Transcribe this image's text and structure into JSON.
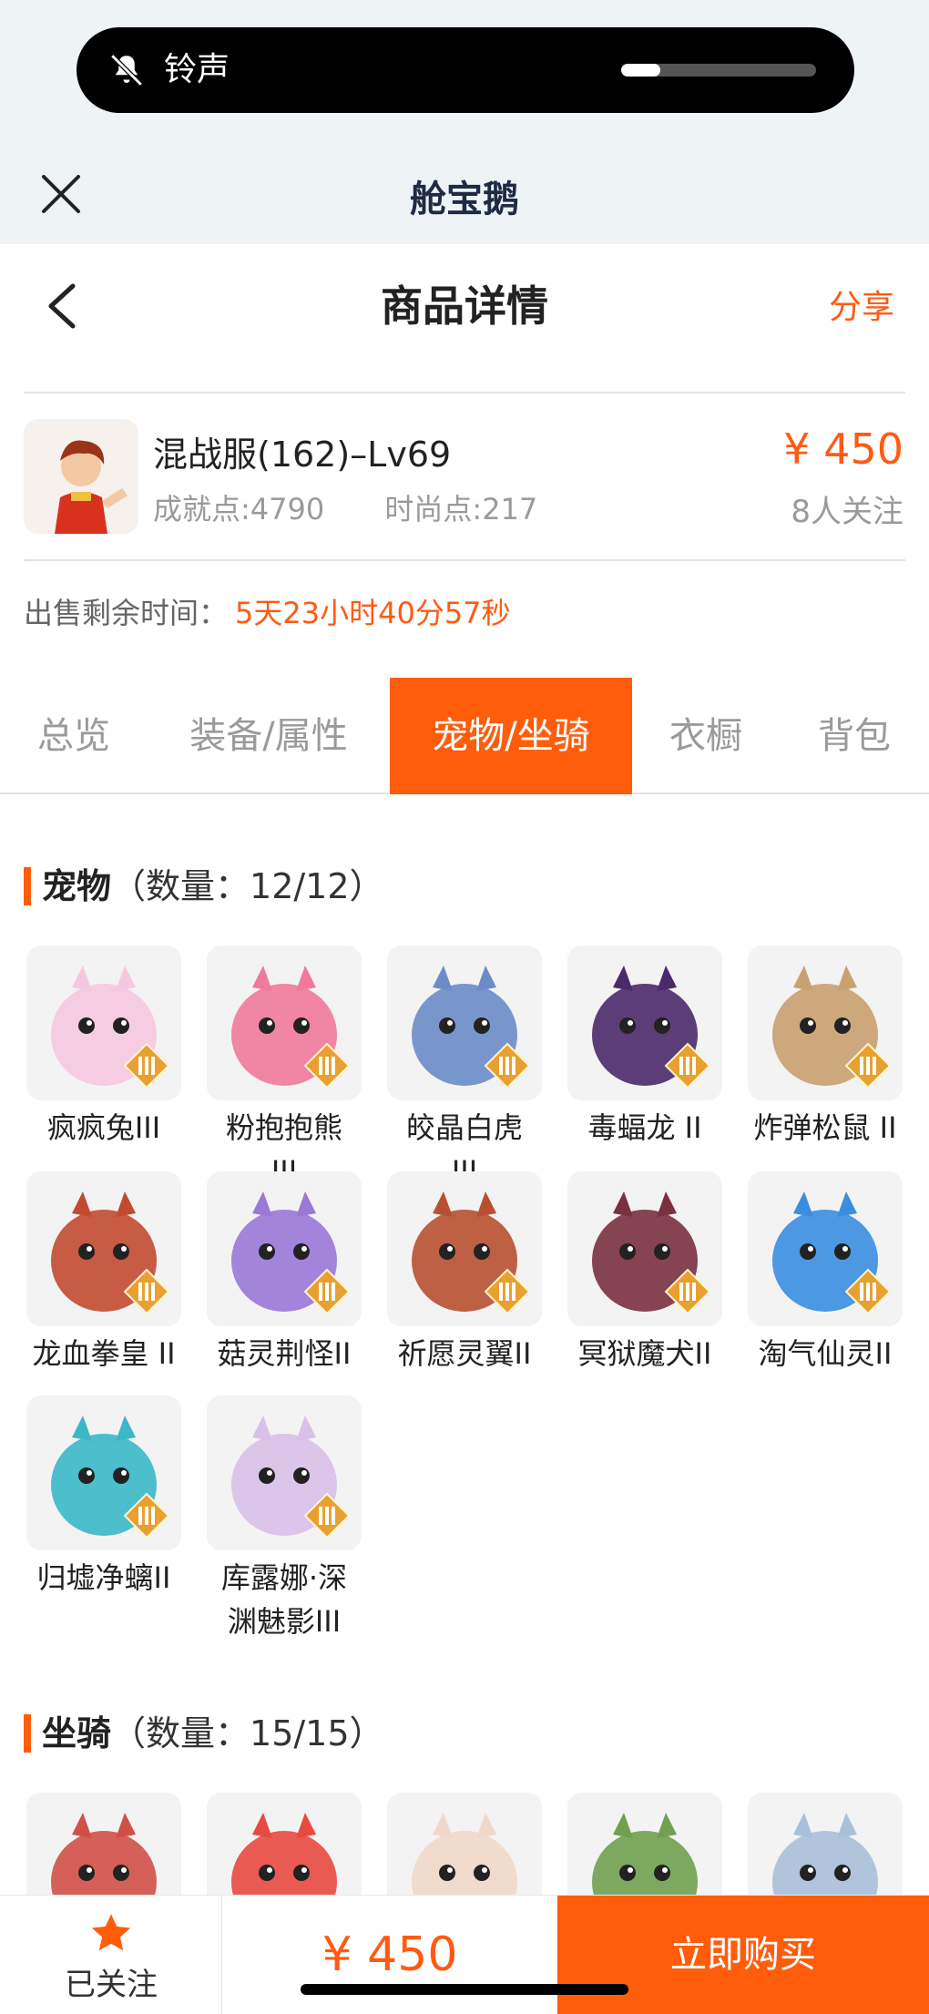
{
  "status": {
    "ringer_label": "铃声",
    "ringer_level": 0.2
  },
  "app": {
    "title": "舱宝鹅"
  },
  "header": {
    "title": "商品详情",
    "share_label": "分享"
  },
  "product": {
    "name": "混战服(162)–Lv69",
    "achievement": "成就点:4790",
    "fashion": "时尚点:217",
    "price": "¥ 450",
    "followers": "8人关注",
    "remaining_label": "出售剩余时间：",
    "remaining_time": "5天23小时40分57秒"
  },
  "tabs": [
    {
      "label": "总览"
    },
    {
      "label": "装备/属性"
    },
    {
      "label": "宠物/坐骑"
    },
    {
      "label": "衣橱"
    },
    {
      "label": "背包"
    }
  ],
  "active_tab": 2,
  "pets_section": {
    "title": "宠物",
    "count": "（数量：12/12）",
    "items": [
      {
        "name": "疯疯兔III",
        "color": "#f5c8e0"
      },
      {
        "name": "粉抱抱熊 III",
        "color": "#f07a9a"
      },
      {
        "name": "皎晶白虎 III",
        "color": "#6b8cc8"
      },
      {
        "name": "毒蝠龙 II",
        "color": "#4a2a6a"
      },
      {
        "name": "炸弹松鼠 II",
        "color": "#c9a070"
      },
      {
        "name": "龙血拳皇 II",
        "color": "#c24a30"
      },
      {
        "name": "菇灵荆怪II",
        "color": "#9a78d8"
      },
      {
        "name": "祈愿灵翼II",
        "color": "#b85030"
      },
      {
        "name": "冥狱魔犬II",
        "color": "#7a3040"
      },
      {
        "name": "淘气仙灵II",
        "color": "#3a8ee0"
      },
      {
        "name": "归墟净螭II",
        "color": "#3ab8c8"
      },
      {
        "name": "库露娜·深渊魅影III",
        "color": "#d8c0e8"
      }
    ]
  },
  "mounts_section": {
    "title": "坐骑",
    "count": "（数量：15/15）",
    "items": [
      {
        "color": "#d05048"
      },
      {
        "color": "#e84a40"
      },
      {
        "color": "#f0d8c8"
      },
      {
        "color": "#70a050"
      },
      {
        "color": "#a8c0d8"
      }
    ]
  },
  "bottom": {
    "follow_label": "已关注",
    "price": "¥ 450",
    "buy_label": "立即购买"
  }
}
